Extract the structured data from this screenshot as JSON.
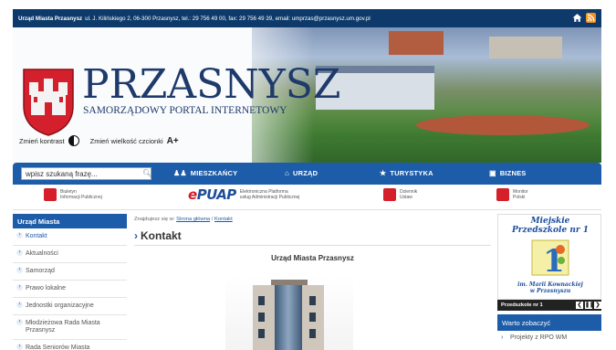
{
  "topbar": {
    "name": "Urząd Miasta Przasnysz",
    "address": "ul. J. Kilińskiego 2, 06-300 Przasnysz, tel.: 29 756 49 00, fax: 29 756 49 39, email: umprzas@przasnysz.um.gov.pl"
  },
  "header": {
    "title": "PRZASNYSZ",
    "subtitle": "SAMORZĄDOWY PORTAL INTERNETOWY",
    "contrast_label": "Zmień kontrast",
    "fontsize_label": "Zmień wielkość czcionki",
    "fontsize_icon_text": "A+"
  },
  "nav": {
    "search_value": "wpisz szukaną frazę...",
    "items": [
      {
        "label": "MIESZKAŃCY",
        "icon": "people-icon"
      },
      {
        "label": "URZĄD",
        "icon": "home-icon"
      },
      {
        "label": "TURYSTYKA",
        "icon": "hiker-icon"
      },
      {
        "label": "BIZNES",
        "icon": "briefcase-icon"
      }
    ]
  },
  "banners": {
    "bip_line1": "Biuletyn",
    "bip_line2": "Informacji Publicznej",
    "epuap_logo_a": "e",
    "epuap_logo_b": "PUAP",
    "epuap_line1": "Elektroniczna Platforma",
    "epuap_line2": "usług Administracji Publicznej",
    "dziennik_line1": "Dziennik",
    "dziennik_line2": "Ustaw",
    "monitor_line1": "Monitor",
    "monitor_line2": "Polski"
  },
  "sidebar": {
    "heading": "Urząd Miasta",
    "items": [
      "Kontakt",
      "Aktualności",
      "Samorząd",
      "Prawo lokalne",
      "Jednostki organizacyjne",
      "Młodzieżowa Rada Miasta Przasnysz",
      "Rada Seniorów Miasta"
    ]
  },
  "main": {
    "breadcrumb_prefix": "Znajdujesz się w:",
    "breadcrumb_home": "Strona główna",
    "breadcrumb_sep": "/",
    "breadcrumb_current": "Kontakt",
    "page_title": "Kontakt",
    "section_title": "Urząd Miasta Przasnysz"
  },
  "right": {
    "promo_line1": "Miejskie",
    "promo_line2": "Przedszkole nr 1",
    "promo_digit": "1",
    "promo_line3": "im. Marii Kownackiej",
    "promo_line4": "w Przasnyszu",
    "slider_caption": "Przedszkole nr 1",
    "see_heading": "Warto zobaczyć",
    "see_item": "Projekty z RPO WM"
  },
  "colors": {
    "topbar": "#0d3a6a",
    "nav": "#1c5ca8",
    "title": "#1e3a6b",
    "epuap_red": "#d81b2a",
    "rss": "#f39019"
  }
}
